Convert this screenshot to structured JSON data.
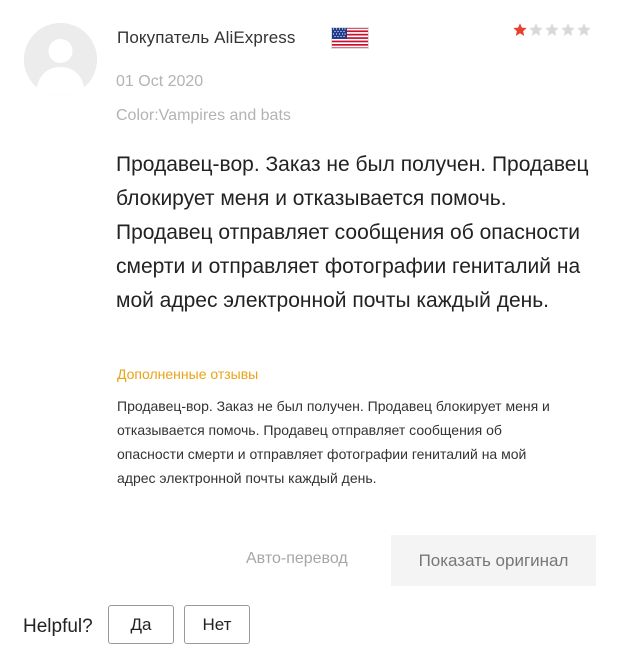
{
  "review": {
    "user_name": "Покупатель AliExpress",
    "country_flag_icon": "us-flag-icon",
    "rating": 1,
    "rating_max": 5,
    "date": "01 Oct 2020",
    "variant": "Color:Vampires and bats",
    "text": "Продавец-вор. Заказ не был получен. Продавец блокирует меня и отказывается помочь. Продавец отправляет сообщения об опасности смерти и отправляет фотографии гениталий на мой адрес электронной почты каждый день."
  },
  "additional": {
    "title": "Дополненные отзывы",
    "text": "Продавец-вор. Заказ не был получен. Продавец блокирует меня и отказывается помочь. Продавец отправляет сообщения об опасности смерти и отправляет фотографии гениталий на мой адрес электронной почты каждый день."
  },
  "translation": {
    "label": "Авто-перевод",
    "show_original_label": "Показать оригинал"
  },
  "helpful": {
    "label": "Helpful?",
    "yes_label": "Да",
    "no_label": "Нет"
  },
  "colors": {
    "star_filled": "#e8402f",
    "star_empty": "#d9d9d9",
    "accent": "#e8a317"
  }
}
